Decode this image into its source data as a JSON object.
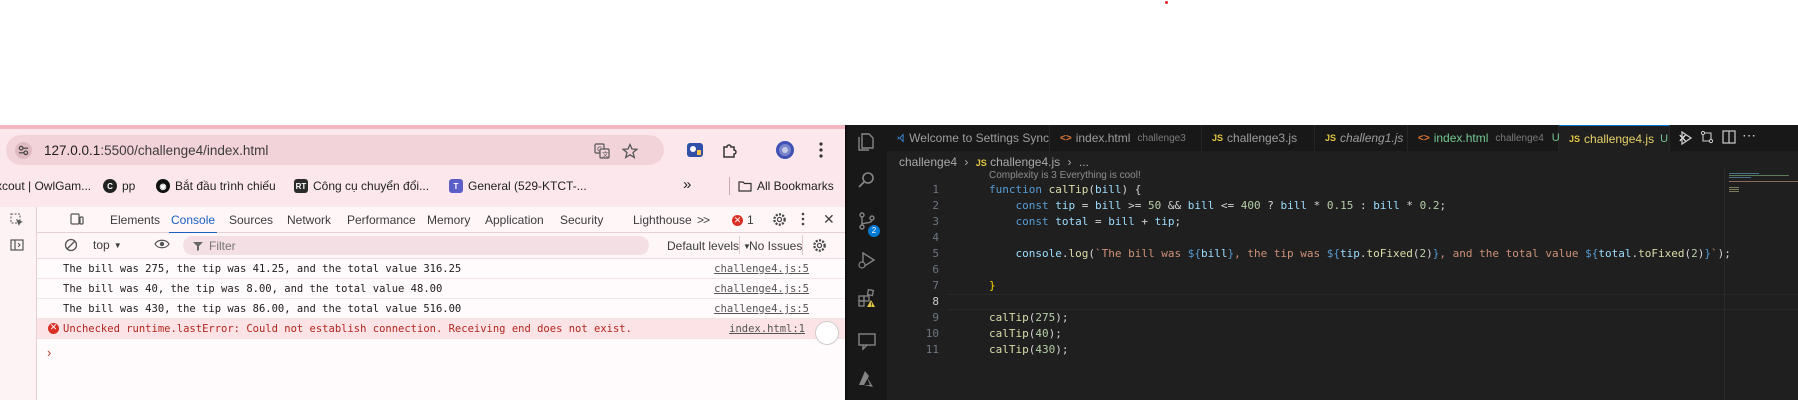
{
  "browser": {
    "url_prefix": "127.0.0.1",
    "url_rest": ":5500/challenge4/index.html",
    "bookmarks": [
      {
        "label": "xcout | OwlGam..."
      },
      {
        "label": "pp"
      },
      {
        "label": "Bắt đầu trình chiếu"
      },
      {
        "label": "Công cụ chuyển đổi..."
      },
      {
        "label": "General (529-KTCT-..."
      }
    ],
    "more_label": "»",
    "all_bookmarks_label": "All Bookmarks"
  },
  "devtools": {
    "tabs": [
      "Elements",
      "Console",
      "Sources",
      "Network",
      "Performance",
      "Memory",
      "Application",
      "Security",
      "Lighthouse"
    ],
    "tabs_more": ">>",
    "error_count": "1",
    "context": "top",
    "filter_placeholder": "Filter",
    "levels": "Default levels",
    "issues": "No Issues",
    "logs": [
      {
        "msg": "The bill was 275, the tip was 41.25, and the total value 316.25",
        "src": "challenge4.js:5"
      },
      {
        "msg": "The bill was 40, the tip was 8.00, and the total value 48.00",
        "src": "challenge4.js:5"
      },
      {
        "msg": "The bill was 430, the tip was 86.00, and the total value 516.00",
        "src": "challenge4.js:5"
      }
    ],
    "error": {
      "msg": "Unchecked runtime.lastError: Could not establish connection. Receiving end does not exist.",
      "src": "index.html:1"
    },
    "prompt": "›"
  },
  "vscode": {
    "tabs": [
      {
        "label": "Welcome to Settings Sync",
        "sub": "",
        "mod": ""
      },
      {
        "label": "index.html",
        "sub": "challenge3",
        "mod": ""
      },
      {
        "label": "challenge3.js",
        "sub": "",
        "mod": ""
      },
      {
        "label": "challeng1.js",
        "sub": "",
        "mod": ""
      },
      {
        "label": "index.html",
        "sub": "challenge4",
        "mod": "U"
      },
      {
        "label": "challenge4.js",
        "sub": "",
        "mod": "U"
      }
    ],
    "breadcrumb": {
      "folder": "challenge4",
      "file": "challenge4.js",
      "rest": "..."
    },
    "code_lens": "Complexity is 3 Everything is cool!",
    "line_numbers": [
      "1",
      "2",
      "3",
      "4",
      "5",
      "6",
      "7",
      "8",
      "9",
      "10",
      "11"
    ],
    "source_badge": "2"
  },
  "colors": {
    "chrome_bg": "#fce8ec",
    "console_link": "#1a5fbf",
    "error_red": "#d93025",
    "vscode_bg": "#1f1f1f",
    "js_yellow": "#e2c541"
  }
}
